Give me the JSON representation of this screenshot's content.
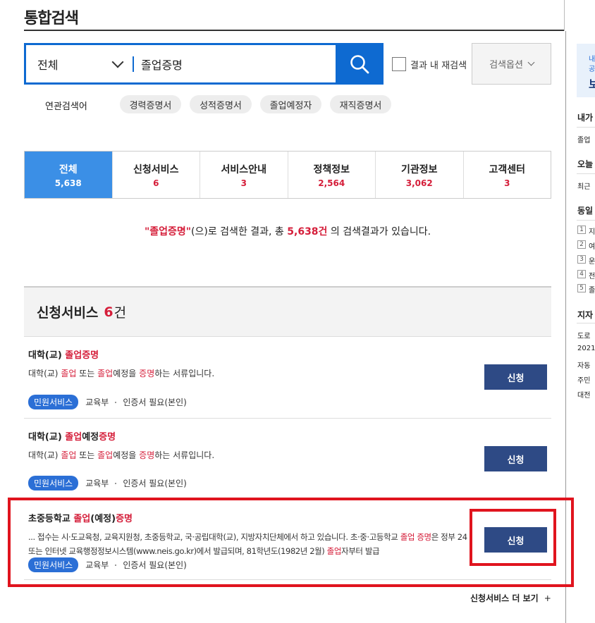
{
  "page": {
    "title": "통합검색"
  },
  "search": {
    "scope": "전체",
    "query": "졸업증명",
    "re_search_label": "결과 내 재검색",
    "options_label": "검색옵션"
  },
  "related": {
    "label": "연관검색어",
    "tags": [
      "경력증명서",
      "성적증명서",
      "졸업예정자",
      "재직증명서"
    ]
  },
  "tabs": [
    {
      "label": "전체",
      "count": "5,638"
    },
    {
      "label": "신청서비스",
      "count": "6"
    },
    {
      "label": "서비스안내",
      "count": "3"
    },
    {
      "label": "정책정보",
      "count": "2,564"
    },
    {
      "label": "기관정보",
      "count": "3,062"
    },
    {
      "label": "고객센터",
      "count": "3"
    }
  ],
  "summary": {
    "keyword": "\"졸업증명\"",
    "pre": "(으)로 검색한 결과, 총 ",
    "total": "5,638건",
    "post": " 의 검색결과가 있습니다."
  },
  "section": {
    "title": "신청서비스",
    "count": "6",
    "unit": "건"
  },
  "items": [
    {
      "title": [
        "대학(교) ",
        "졸업",
        "증명"
      ],
      "desc": [
        "대학(교) ",
        "졸업",
        " 또는 ",
        "졸업",
        "예정을 ",
        "증명",
        "하는 서류입니다."
      ],
      "badge": "민원서비스",
      "org": "교육부",
      "auth": "인증서 필요(본인)",
      "button": "신청"
    },
    {
      "title": [
        "대학(교) ",
        "졸업",
        "예정",
        "증명"
      ],
      "desc": [
        "대학(교) ",
        "졸업",
        " 또는 ",
        "졸업",
        "예정을 ",
        "증명",
        "하는 서류입니다."
      ],
      "badge": "민원서비스",
      "org": "교육부",
      "auth": "인증서 필요(본인)",
      "button": "신청"
    },
    {
      "title": [
        "초중등학교 ",
        "졸업",
        "(예정)",
        "증명"
      ],
      "desc": [
        "... 접수는 시·도교육청, 교육지원청, 초중등학교, 국·공립대학(교), 지방자치단체에서 하고 있습니다. 초·중·고등학교 ",
        "졸업",
        " ",
        "증명",
        "은 정부 24 또는 인터넷 교육행정정보시스템(www.neis.go.kr)에서 발급되며, 81학년도(1982년 2월) ",
        "졸업",
        "자부터 발급"
      ],
      "badge": "민원서비스",
      "org": "교육부",
      "auth": "인증서 필요(본인)",
      "button": "신청"
    }
  ],
  "more": {
    "label": "신청서비스 더 보기",
    "plus": "+"
  },
  "sidebar": {
    "banner": [
      "내",
      "공",
      "보"
    ],
    "h1": "내가",
    "l1": "졸업",
    "h2": "오늘",
    "l2": "최근",
    "h3": "동일",
    "ranks": [
      {
        "n": "1",
        "t": "지"
      },
      {
        "n": "2",
        "t": "여"
      },
      {
        "n": "3",
        "t": "운"
      },
      {
        "n": "4",
        "t": "전"
      },
      {
        "n": "5",
        "t": "졸"
      }
    ],
    "h4": "지자",
    "news": [
      "도로",
      "2021",
      "자동",
      "주민",
      "대전"
    ]
  }
}
